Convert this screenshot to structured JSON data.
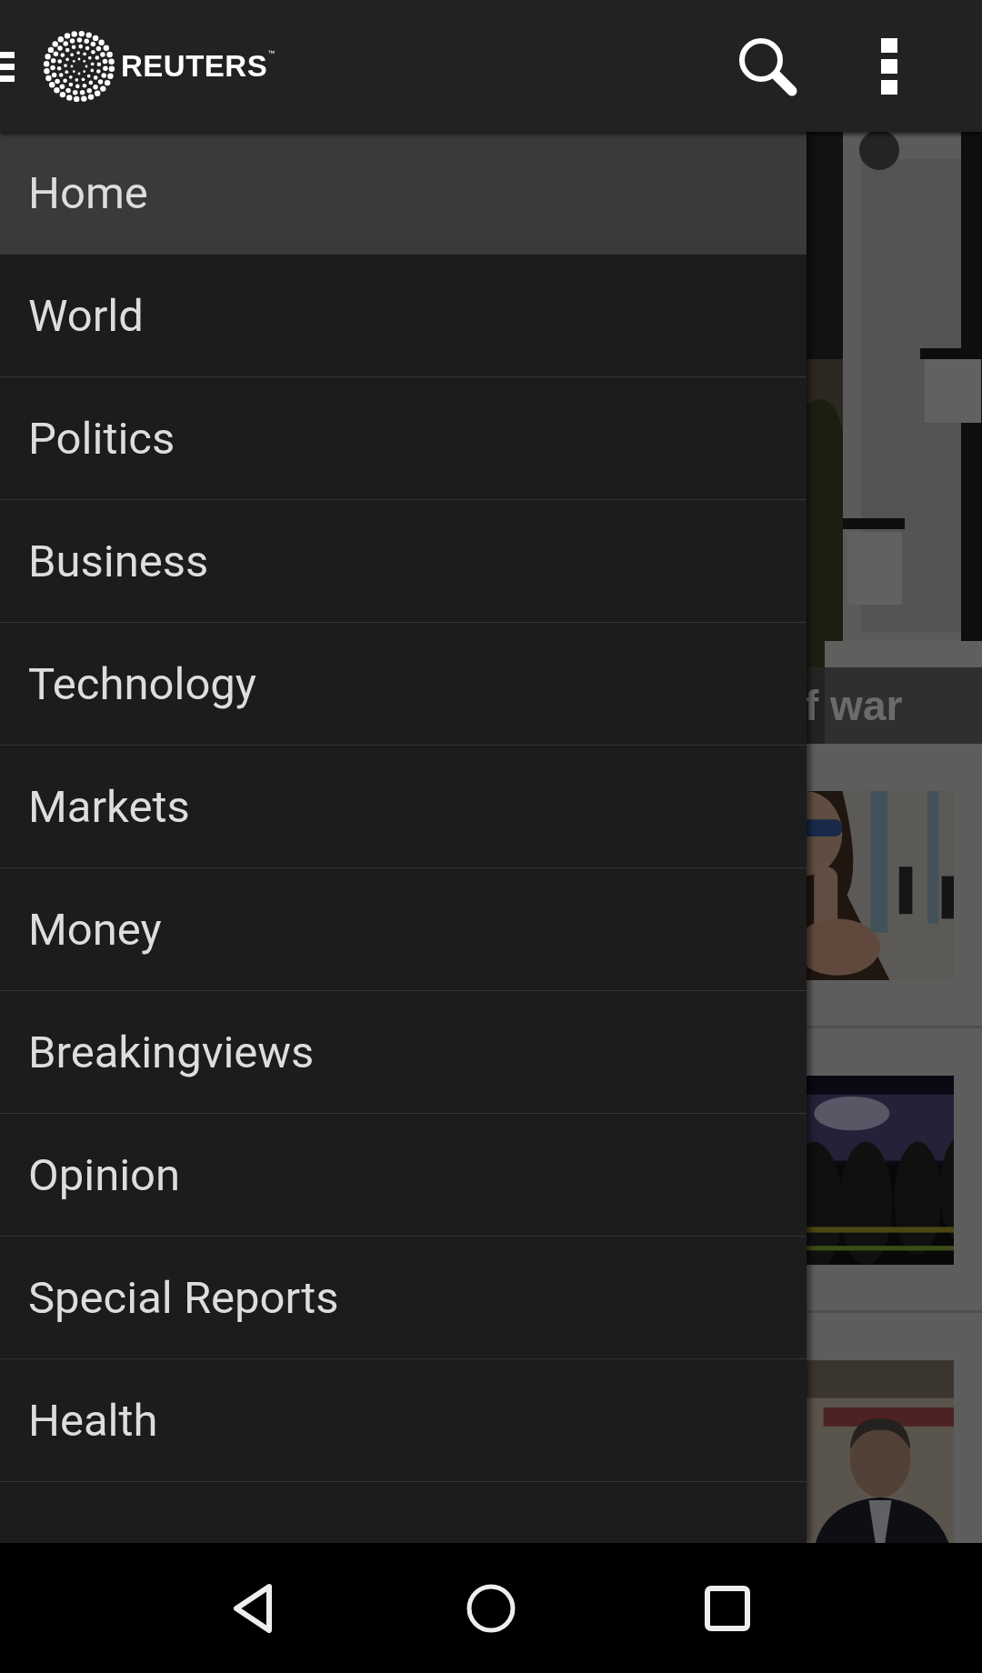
{
  "app_bar": {
    "logo_text": "REUTERS$^{™}$"
  },
  "drawer": {
    "items": [
      {
        "label": "Home",
        "selected": true
      },
      {
        "label": "World",
        "selected": false
      },
      {
        "label": "Politics",
        "selected": false
      },
      {
        "label": "Business",
        "selected": false
      },
      {
        "label": "Technology",
        "selected": false
      },
      {
        "label": "Markets",
        "selected": false
      },
      {
        "label": "Money",
        "selected": false
      },
      {
        "label": "Breakingviews",
        "selected": false
      },
      {
        "label": "Opinion",
        "selected": false
      },
      {
        "label": "Special Reports",
        "selected": false
      },
      {
        "label": "Health",
        "selected": false
      }
    ]
  },
  "content": {
    "hero": {
      "kind": "picture",
      "headline": "f war"
    }
  }
}
